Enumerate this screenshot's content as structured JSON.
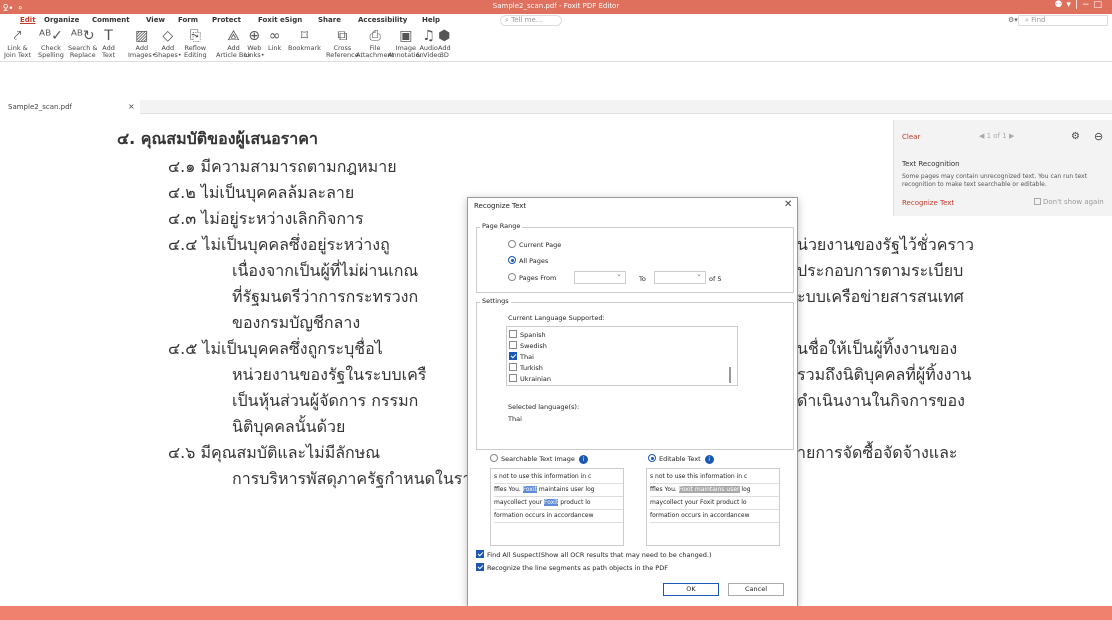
{
  "window": {
    "title": "Sample2_scan.pdf - Foxit PDF Editor",
    "quick_access": "ꝿ• ⚬"
  },
  "menu": [
    "Edit",
    "Organize",
    "Comment",
    "View",
    "Form",
    "Protect",
    "Foxit eSign",
    "Share",
    "Accessibility",
    "Help"
  ],
  "tell_me": "Tell me...",
  "find": "Find",
  "ribbon": [
    {
      "icon": "text-link-icon",
      "glyph": "⤤",
      "label": "Link &\nJoin Text"
    },
    {
      "icon": "spell-check-icon",
      "glyph": "ᴬᴮ✓",
      "label": "Check\nSpelling"
    },
    {
      "icon": "search-replace-icon",
      "glyph": "ᴬᴮ↻",
      "label": "Search &\nReplace"
    },
    {
      "icon": "add-text-icon",
      "glyph": "T",
      "label": "Add\nText"
    },
    {
      "icon": "add-image-icon",
      "glyph": "▨",
      "label": "Add\nImages•"
    },
    {
      "icon": "add-shape-icon",
      "glyph": "◇",
      "label": "Add\nShapes•"
    },
    {
      "icon": "reflow-icon",
      "glyph": "⎘",
      "label": "Reflow\nEditing"
    },
    {
      "icon": "article-box-icon",
      "glyph": "⟁",
      "label": "Add\nArticle Box"
    },
    {
      "icon": "web-links-icon",
      "glyph": "⊕",
      "label": "Web\nLinks•"
    },
    {
      "icon": "link-icon",
      "glyph": "∞",
      "label": "Link"
    },
    {
      "icon": "bookmark-icon",
      "glyph": "⌑",
      "label": "Bookmark"
    },
    {
      "icon": "cross-reference-icon",
      "glyph": "⧉",
      "label": "Cross\nReference"
    },
    {
      "icon": "file-attachment-icon",
      "glyph": "⎙",
      "label": "File\nAttachment"
    },
    {
      "icon": "image-annotation-icon",
      "glyph": "▣",
      "label": "Image\nAnnotation"
    },
    {
      "icon": "audio-video-icon",
      "glyph": "♫",
      "label": "Audio\n& Video"
    },
    {
      "icon": "add-3d-icon",
      "glyph": "⬢",
      "label": "Add\n3D"
    }
  ],
  "tab": {
    "label": "Sample2_scan.pdf"
  },
  "document": {
    "lines": [
      "๔. คุณสมบัติของผู้เสนอราคา",
      "๔.๑   มีความสามารถตามกฎหมาย",
      "๔.๒   ไม่เป็นบุคคลล้มละลาย",
      "๔.๓   ไม่อยู่ระหว่างเลิกกิจการ",
      "๔.๔   ไม่เป็นบุคคลซึ่งอยู่ระหว่างถู",
      "เนื่องจากเป็นผู้ที่ไม่ผ่านเกณ",
      "ที่รัฐมนตรีว่าการกระทรวงก",
      "ของกรมบัญชีกลาง",
      "๔.๕   ไม่เป็นบุคคลซึ่งถูกระบุชื่อไ",
      "หน่วยงานของรัฐในระบบเครื",
      "เป็นหุ้นส่วนผู้จัดการ  กรรมก",
      "นิติบุคคลนั้นด้วย",
      "๔.๖   มีคุณสมบัติและไม่มีลักษณ",
      "การบริหารพัสดุภาครัฐกำหนดในราชกิจจานุเบกษา"
    ],
    "right_lines": [
      "น่วยงานของรัฐไว้ชั่วคราว",
      "ประกอบการตามระเบียบ",
      "ะบบเครือข่ายสารสนเทศ",
      "นชื่อให้เป็นผู้ทิ้งงานของ",
      "รวมถึงนิติบุคคลที่ผู้ทิ้งงาน",
      "ดำเนินงานในกิจการของ",
      "ายการจัดซื้อจัดจ้างและ"
    ]
  },
  "text_panel": {
    "clear": "Clear",
    "page_indicator": "1 of 1",
    "title": "Text Recognition",
    "body": "Some pages may contain unrecognized text. You can run text recognition to make text searchable or editable.",
    "recognize_link": "Recognize Text",
    "dont_show": "Don't show again"
  },
  "dialog": {
    "title": "Recognize Text",
    "page_range_label": "Page Range",
    "current_page": "Current Page",
    "all_pages": "All Pages",
    "pages_from": "Pages From",
    "to": "To",
    "of": "of  5",
    "settings_label": "Settings",
    "current_language_label": "Current Language Supported:",
    "languages": [
      {
        "name": "Spanish",
        "checked": false
      },
      {
        "name": "Swedish",
        "checked": false
      },
      {
        "name": "Thai",
        "checked": true
      },
      {
        "name": "Turkish",
        "checked": false
      },
      {
        "name": "Ukrainian",
        "checked": false
      }
    ],
    "selected_label": "Selected language(s):",
    "selected_value": "Thai",
    "searchable_label": "Searchable Text Image",
    "editable_label": "Editable Text",
    "preview_lines": [
      "s not to use this information in c",
      "ffles You. Foxit maintains user log",
      "maycollect your Foxit product lo",
      "formation occurs in accordancew"
    ],
    "find_suspect": "Find All Suspect(Show all OCR results that may need to be changed.)",
    "path_objects": "Recognize the line segments as path objects in the PDF",
    "ok": "OK",
    "cancel": "Cancel"
  },
  "colors": {
    "accent": "#c03a2b",
    "frame": "#f0816e",
    "titlebar": "#e0705e",
    "checkbox": "#1a58b3"
  }
}
